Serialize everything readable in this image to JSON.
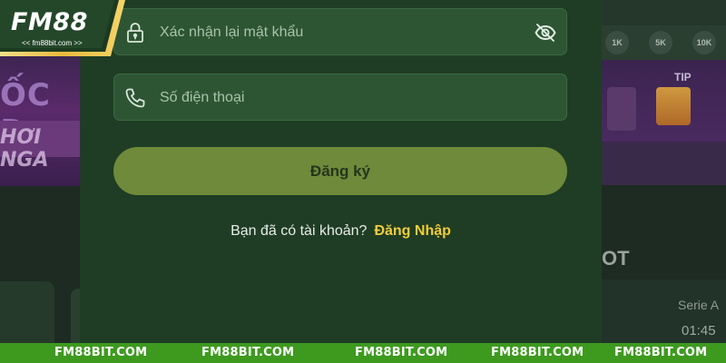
{
  "logo": {
    "brand": "FM88",
    "sub": "<< fm88bit.com >>"
  },
  "form": {
    "confirm_password_placeholder": "Xác nhận lại mật khẩu",
    "phone_placeholder": "Số điện thoại",
    "submit_label": "Đăng ký",
    "login_prompt": "Bạn đã có tài khoản?",
    "login_link": "Đăng Nhập"
  },
  "background": {
    "left_banner_text": "ỐC Đ",
    "left_button_text": "HƠI NGA",
    "right_tip": "TIP",
    "right_hot": "OT",
    "right_league": "Serie A",
    "right_time": "01:45",
    "right_chips": [
      "1K",
      "5K",
      "10K"
    ]
  },
  "footer": {
    "items": [
      "FM88BIT.COM",
      "FM88BIT.COM",
      "FM88BIT.COM",
      "FM88BIT.COM",
      "FM88BIT.COM"
    ]
  },
  "colors": {
    "panel": "#1f3d24",
    "field": "#2d5533",
    "submit": "#6e8a3a",
    "link": "#f0cc3a",
    "footer": "#3d9a1f"
  }
}
